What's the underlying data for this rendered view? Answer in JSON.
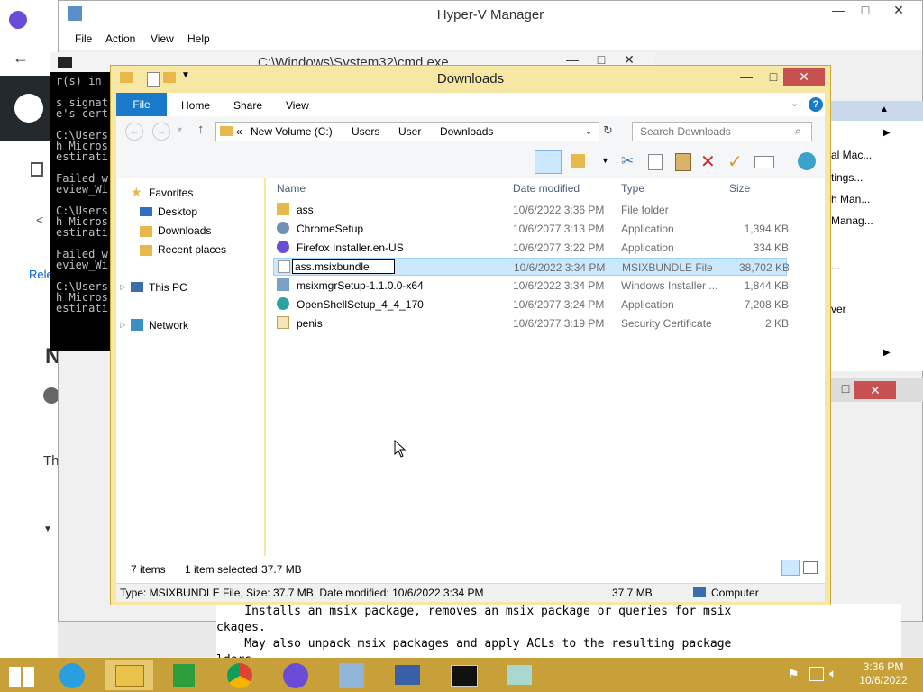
{
  "hyperv": {
    "title": "Hyper-V Manager",
    "menu": [
      "File",
      "Action",
      "View",
      "Help"
    ],
    "actions": [
      "al Mac...",
      "tings...",
      "h Man...",
      "Manag...",
      "...",
      "ver"
    ]
  },
  "cmd": {
    "title": "C:\\Windows\\System32\\cmd.exe",
    "lines": [
      "r(s) in",
      "",
      "s signat",
      "e's cert",
      "",
      "C:\\Users",
      "h Micros",
      "estinati",
      "",
      "Failed w",
      "eview_Wi",
      "",
      "C:\\Users",
      "h Micros",
      "estinati",
      "",
      "Failed w",
      "eview_Wi",
      "",
      "C:\\Users",
      "h Micros",
      "estinati"
    ],
    "help_lines": [
      "    Installs an msix package, removes an msix package or queries for msix",
      "ckages.",
      "    May also unpack msix packages and apply ACLs to the resulting package",
      "lders"
    ]
  },
  "browser": {
    "items": [
      "Rele",
      "N",
      "Th"
    ]
  },
  "explorer": {
    "title": "Downloads",
    "tabs": [
      "File",
      "Home",
      "Share",
      "View"
    ],
    "breadcrumb": [
      "«",
      "New Volume (C:)",
      "Users",
      "User",
      "Downloads"
    ],
    "search_placeholder": "Search Downloads",
    "columns": {
      "name": "Name",
      "date": "Date modified",
      "type": "Type",
      "size": "Size"
    },
    "nav": {
      "favorites": "Favorites",
      "desktop": "Desktop",
      "downloads": "Downloads",
      "recent": "Recent places",
      "thispc": "This PC",
      "network": "Network"
    },
    "files": [
      {
        "name": "ass",
        "date": "10/6/2022 3:36 PM",
        "type": "File folder",
        "size": "",
        "icon": "folder-icon"
      },
      {
        "name": "ChromeSetup",
        "date": "10/6/2077 3:13 PM",
        "type": "Application",
        "size": "1,394 KB",
        "icon": "chrome-setup-icon"
      },
      {
        "name": "Firefox Installer.en-US",
        "date": "10/6/2077 3:22 PM",
        "type": "Application",
        "size": "334 KB",
        "icon": "firefox-icon"
      },
      {
        "name": "ass.msixbundle",
        "date": "10/6/2022 3:34 PM",
        "type": "MSIXBUNDLE File",
        "size": "38,702 KB",
        "icon": "file-icon",
        "selected": true,
        "renaming": true
      },
      {
        "name": "msixmgrSetup-1.1.0.0-x64",
        "date": "10/6/2022 3:34 PM",
        "type": "Windows Installer ...",
        "size": "1,844 KB",
        "icon": "installer-icon"
      },
      {
        "name": "OpenShellSetup_4_4_170",
        "date": "10/6/2077 3:24 PM",
        "type": "Application",
        "size": "7,208 KB",
        "icon": "openshell-icon"
      },
      {
        "name": "penis",
        "date": "10/6/2077 3:19 PM",
        "type": "Security Certificate",
        "size": "2 KB",
        "icon": "certificate-icon"
      }
    ],
    "status": {
      "items": "7 items",
      "selected": "1 item selected",
      "selected_size": "37.7 MB"
    },
    "statusbar": {
      "details": "Type: MSIXBUNDLE File, Size: 37.7 MB, Date modified: 10/6/2022 3:34 PM",
      "size": "37.7 MB",
      "location": "Computer"
    }
  },
  "taskbar": {
    "time": "3:36 PM",
    "date": "10/6/2022"
  },
  "colors": {
    "accent": "#1979ca",
    "taskbar": "#c8a03a",
    "selection": "#cce8ff",
    "close": "#c75050"
  }
}
